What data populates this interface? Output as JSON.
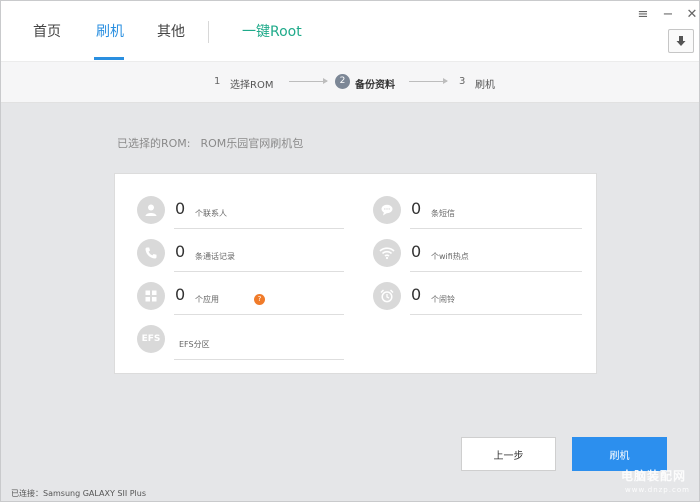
{
  "tabs": [
    {
      "label": "首页"
    },
    {
      "label": "刷机"
    },
    {
      "label": "其他"
    }
  ],
  "root_tab": {
    "label": "一键Root"
  },
  "window_controls": {
    "menu": "≡",
    "minimize": "−",
    "close": "✕"
  },
  "steps": [
    {
      "num": "1",
      "label": "选择ROM"
    },
    {
      "num": "2",
      "label": "备份资料"
    },
    {
      "num": "3",
      "label": "刷机"
    }
  ],
  "selected_rom": {
    "label": "已选择的ROM:",
    "value": "ROM乐园官网刷机包"
  },
  "backup_items": {
    "contacts": {
      "count": "0",
      "label": "个联系人",
      "icon": "person-icon"
    },
    "sms": {
      "count": "0",
      "label": "条短信",
      "icon": "message-icon"
    },
    "calls": {
      "count": "0",
      "label": "条通话记录",
      "icon": "phone-icon"
    },
    "wifi": {
      "count": "0",
      "label": "个wifi热点",
      "icon": "wifi-icon"
    },
    "apps": {
      "count": "0",
      "label": "个应用",
      "icon": "apps-icon"
    },
    "alarms": {
      "count": "0",
      "label": "个闹铃",
      "icon": "alarm-icon"
    },
    "efs": {
      "icon_text": "EFS",
      "label": "EFS分区"
    }
  },
  "help_mark": "?",
  "buttons": {
    "prev": "上一步",
    "flash": "刷机"
  },
  "status": {
    "text": "已连接：Samsung GALAXY SII Plus"
  },
  "watermark": {
    "text": "电脑装配网",
    "sub": "www.dnzp.com"
  },
  "colors": {
    "accent": "#2a8fe0",
    "root": "#1faa8a",
    "help": "#f07b2a",
    "primary_button": "#2c8fee"
  }
}
